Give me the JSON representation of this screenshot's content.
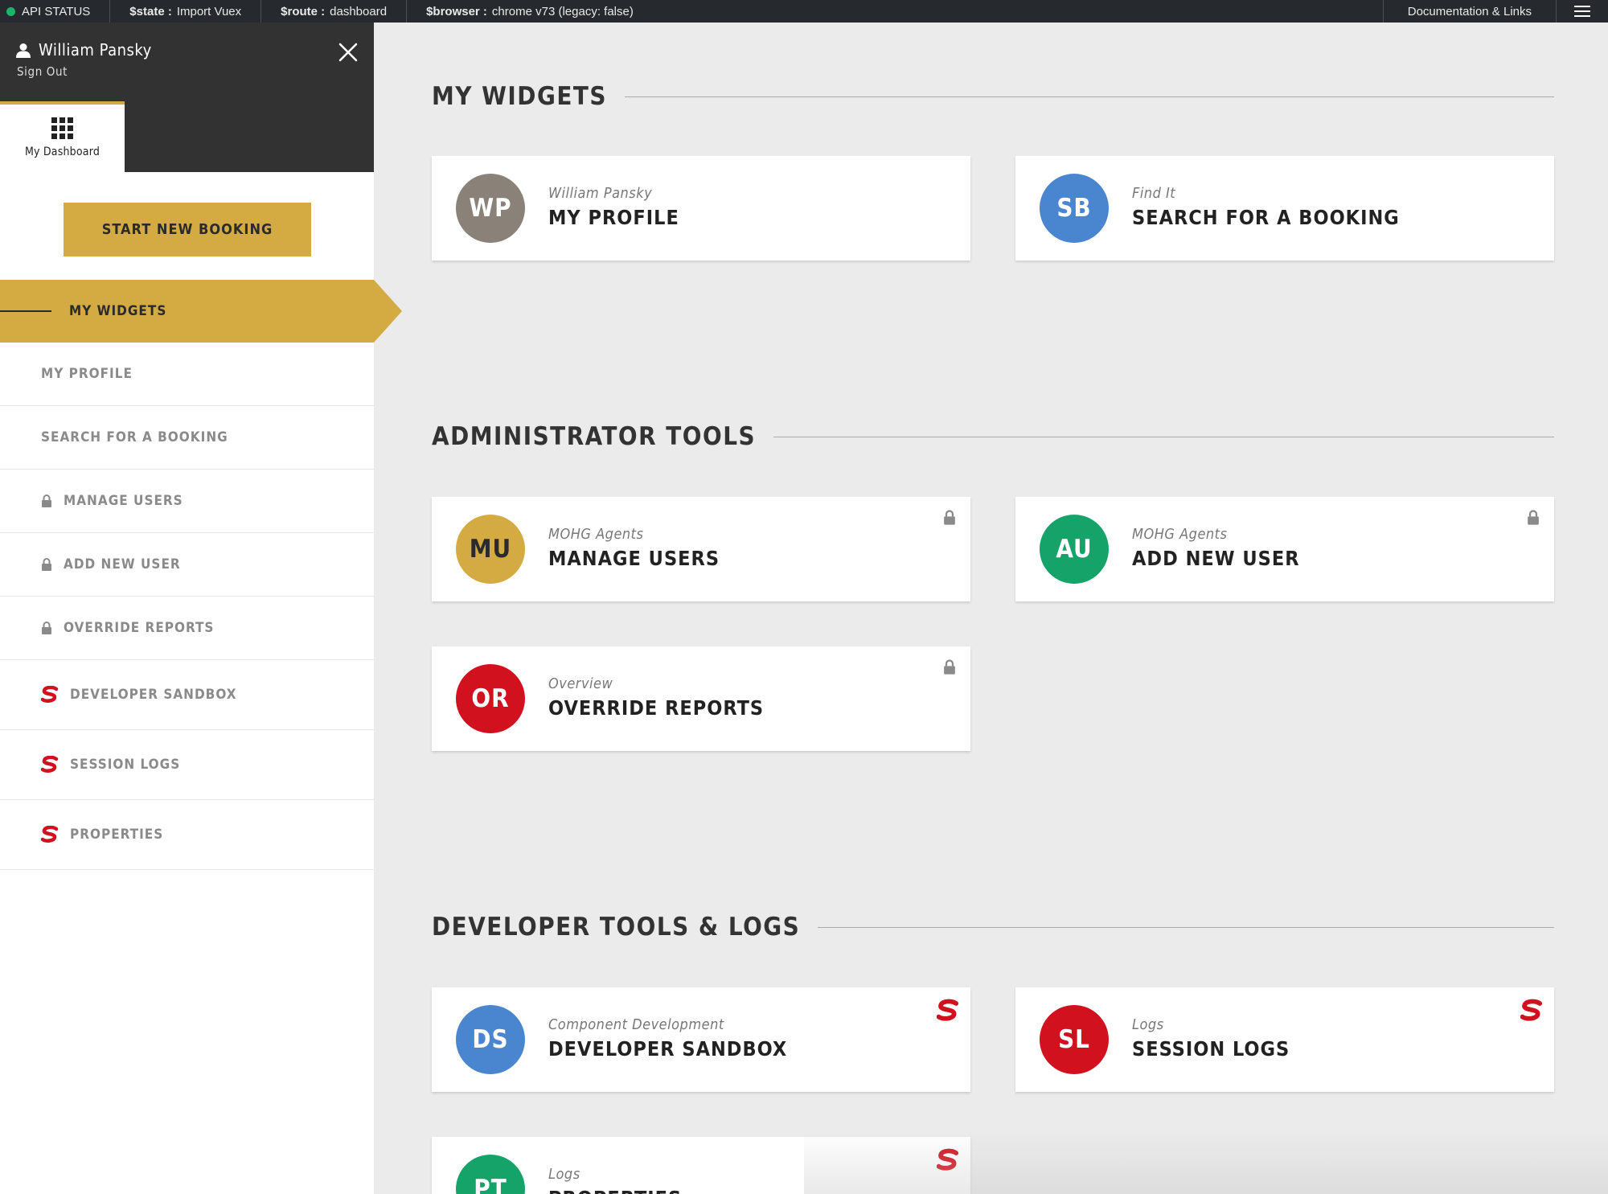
{
  "topbar": {
    "api_status": "API STATUS",
    "state_key": "$state :",
    "state_val": "Import Vuex",
    "route_key": "$route :",
    "route_val": "dashboard",
    "browser_key": "$browser :",
    "browser_val": "chrome v73 (legacy: false)",
    "docs": "Documentation & Links",
    "status_color": "#1db36b"
  },
  "sidebar": {
    "user_name": "William Pansky",
    "sign_out": "Sign Out",
    "dashboard_tab": "My Dashboard",
    "start_button": "START NEW BOOKING",
    "nav": [
      {
        "label": "MY WIDGETS",
        "icon": "none",
        "active": true
      },
      {
        "label": "MY PROFILE",
        "icon": "none"
      },
      {
        "label": "SEARCH FOR A BOOKING",
        "icon": "none"
      },
      {
        "label": "MANAGE USERS",
        "icon": "lock-icon"
      },
      {
        "label": "ADD NEW USER",
        "icon": "lock-icon"
      },
      {
        "label": "OVERRIDE REPORTS",
        "icon": "lock-icon"
      },
      {
        "label": "DEVELOPER SANDBOX",
        "icon": "s-logo-icon"
      },
      {
        "label": "SESSION LOGS",
        "icon": "s-logo-icon"
      },
      {
        "label": "PROPERTIES",
        "icon": "s-logo-icon"
      }
    ]
  },
  "sections": {
    "widgets": {
      "title": "MY WIDGETS",
      "cards": [
        {
          "initials": "WP",
          "sub": "William Pansky",
          "title": "MY PROFILE",
          "color": "#8a8178"
        },
        {
          "initials": "SB",
          "sub": "Find It",
          "title": "SEARCH FOR A BOOKING",
          "color": "#4a86cf"
        }
      ]
    },
    "admin": {
      "title": "ADMINISTRATOR TOOLS",
      "cards": [
        {
          "initials": "MU",
          "sub": "MOHG Agents",
          "title": "MANAGE USERS",
          "color": "#d4ab43",
          "badge": "lock-icon"
        },
        {
          "initials": "AU",
          "sub": "MOHG Agents",
          "title": "ADD NEW USER",
          "color": "#16a36a",
          "badge": "lock-icon"
        },
        {
          "initials": "OR",
          "sub": "Overview",
          "title": "OVERRIDE REPORTS",
          "color": "#d2111e",
          "badge": "lock-icon"
        }
      ]
    },
    "dev": {
      "title": "DEVELOPER TOOLS & LOGS",
      "cards": [
        {
          "initials": "DS",
          "sub": "Component Development",
          "title": "DEVELOPER SANDBOX",
          "color": "#4a86cf",
          "badge": "s-logo-icon"
        },
        {
          "initials": "SL",
          "sub": "Logs",
          "title": "SESSION LOGS",
          "color": "#d2111e",
          "badge": "s-logo-icon"
        },
        {
          "initials": "PT",
          "sub": "Logs",
          "title": "PROPERTIES",
          "color": "#16a36a",
          "badge": "s-logo-icon"
        }
      ]
    }
  },
  "colors": {
    "accent": "#d4ab43",
    "sidebar_header": "#323232",
    "topbar": "#26292d",
    "background": "#ebebeb"
  }
}
